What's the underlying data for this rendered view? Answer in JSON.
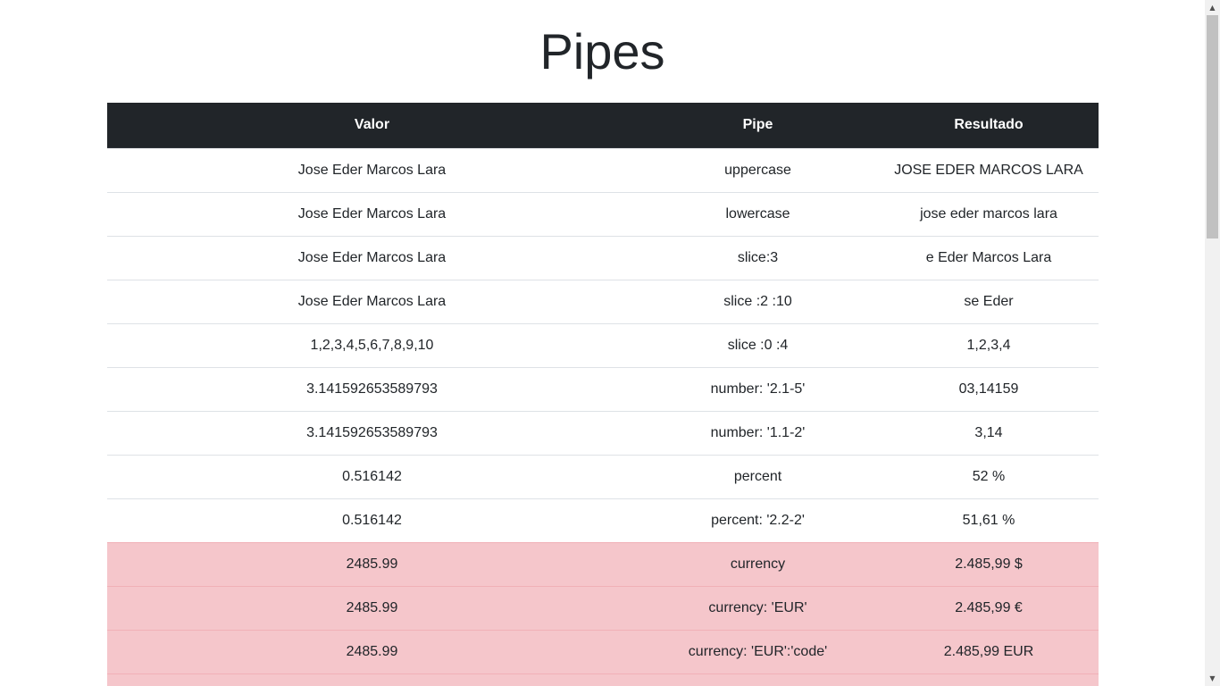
{
  "page": {
    "title": "Pipes"
  },
  "table": {
    "headers": [
      "Valor",
      "Pipe",
      "Resultado"
    ],
    "rows": [
      {
        "valor": "Jose Eder Marcos Lara",
        "pipe": "uppercase",
        "resultado": "JOSE EDER MARCOS LARA",
        "highlight": false
      },
      {
        "valor": "Jose Eder Marcos Lara",
        "pipe": "lowercase",
        "resultado": "jose eder marcos lara",
        "highlight": false
      },
      {
        "valor": "Jose Eder Marcos Lara",
        "pipe": "slice:3",
        "resultado": "e Eder Marcos Lara",
        "highlight": false
      },
      {
        "valor": "Jose Eder Marcos Lara",
        "pipe": "slice :2 :10",
        "resultado": "se Eder",
        "highlight": false
      },
      {
        "valor": "1,2,3,4,5,6,7,8,9,10",
        "pipe": "slice :0 :4",
        "resultado": "1,2,3,4",
        "highlight": false
      },
      {
        "valor": "3.141592653589793",
        "pipe": "number: '2.1-5'",
        "resultado": "03,14159",
        "highlight": false
      },
      {
        "valor": "3.141592653589793",
        "pipe": "number: '1.1-2'",
        "resultado": "3,14",
        "highlight": false
      },
      {
        "valor": "0.516142",
        "pipe": "percent",
        "resultado": "52 %",
        "highlight": false
      },
      {
        "valor": "0.516142",
        "pipe": "percent: '2.2-2'",
        "resultado": "51,61 %",
        "highlight": false
      },
      {
        "valor": "2485.99",
        "pipe": "currency",
        "resultado": "2.485,99 $",
        "highlight": true
      },
      {
        "valor": "2485.99",
        "pipe": "currency: 'EUR'",
        "resultado": "2.485,99 €",
        "highlight": true
      },
      {
        "valor": "2485.99",
        "pipe": "currency: 'EUR':'code'",
        "resultado": "2.485,99 EUR",
        "highlight": true
      },
      {
        "valor": "",
        "pipe": "",
        "resultado": "",
        "highlight": true
      }
    ]
  },
  "colors": {
    "header_bg": "#212529",
    "danger_row_bg": "#f5c6cb",
    "border": "#dee2e6"
  },
  "scrollbar": {
    "up_icon": "scroll-up-arrow-icon",
    "down_icon": "scroll-down-arrow-icon"
  }
}
